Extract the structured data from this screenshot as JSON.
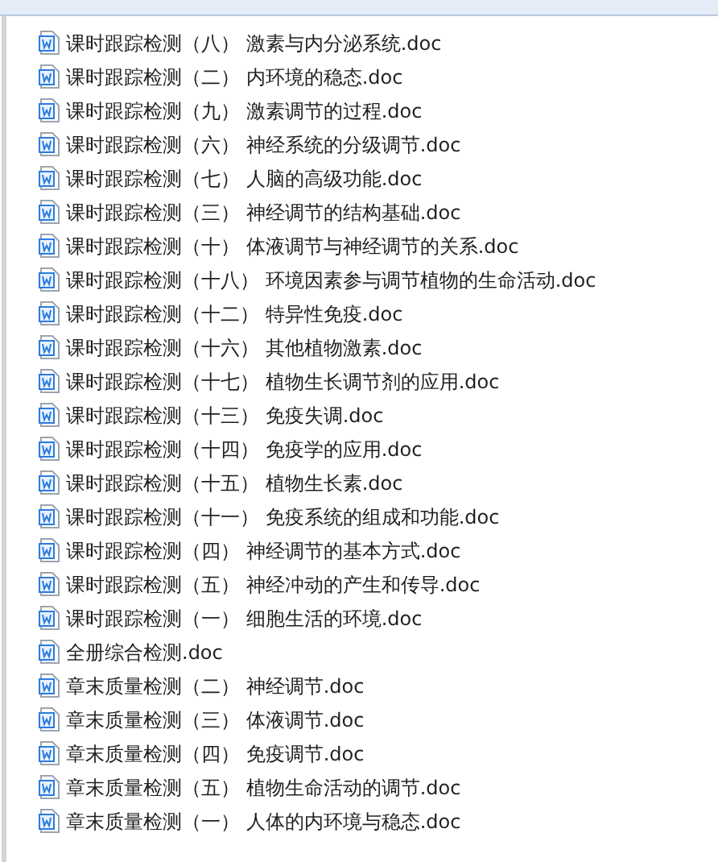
{
  "files": [
    {
      "name": "课时跟踪检测（八） 激素与内分泌系统.doc"
    },
    {
      "name": "课时跟踪检测（二） 内环境的稳态.doc"
    },
    {
      "name": "课时跟踪检测（九） 激素调节的过程.doc"
    },
    {
      "name": "课时跟踪检测（六） 神经系统的分级调节.doc"
    },
    {
      "name": "课时跟踪检测（七） 人脑的高级功能.doc"
    },
    {
      "name": "课时跟踪检测（三） 神经调节的结构基础.doc"
    },
    {
      "name": "课时跟踪检测（十） 体液调节与神经调节的关系.doc"
    },
    {
      "name": "课时跟踪检测（十八） 环境因素参与调节植物的生命活动.doc"
    },
    {
      "name": "课时跟踪检测（十二） 特异性免疫.doc"
    },
    {
      "name": "课时跟踪检测（十六） 其他植物激素.doc"
    },
    {
      "name": "课时跟踪检测（十七） 植物生长调节剂的应用.doc"
    },
    {
      "name": "课时跟踪检测（十三） 免疫失调.doc"
    },
    {
      "name": "课时跟踪检测（十四） 免疫学的应用.doc"
    },
    {
      "name": "课时跟踪检测（十五） 植物生长素.doc"
    },
    {
      "name": "课时跟踪检测（十一） 免疫系统的组成和功能.doc"
    },
    {
      "name": "课时跟踪检测（四） 神经调节的基本方式.doc"
    },
    {
      "name": "课时跟踪检测（五） 神经冲动的产生和传导.doc"
    },
    {
      "name": "课时跟踪检测（一） 细胞生活的环境.doc"
    },
    {
      "name": "全册综合检测.doc"
    },
    {
      "name": "章末质量检测（二） 神经调节.doc"
    },
    {
      "name": "章末质量检测（三） 体液调节.doc"
    },
    {
      "name": "章末质量检测（四） 免疫调节.doc"
    },
    {
      "name": "章末质量检测（五） 植物生命活动的调节.doc"
    },
    {
      "name": "章末质量检测（一） 人体的内环境与稳态.doc"
    }
  ]
}
